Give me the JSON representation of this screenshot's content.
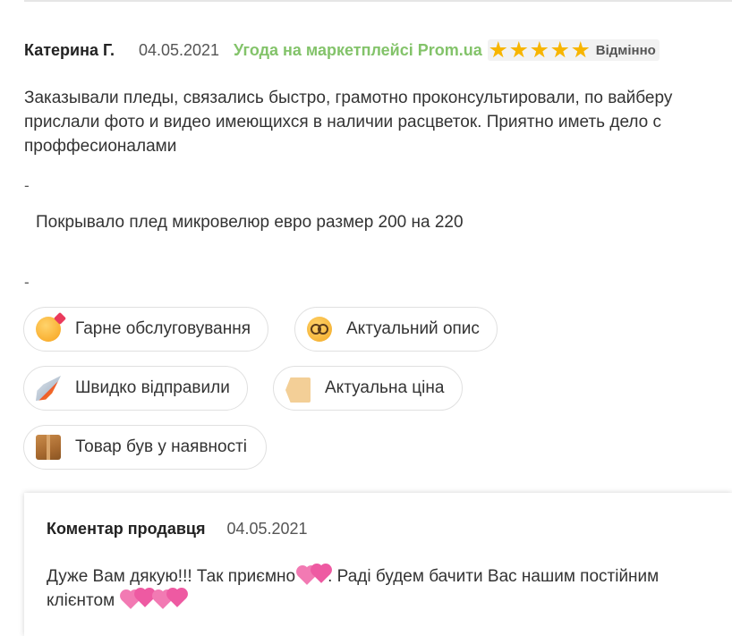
{
  "review": {
    "author": "Катерина Г.",
    "date": "04.05.2021",
    "deal_label": "Угода на маркетплейсі Prom.ua",
    "rating": 5,
    "rating_max": 5,
    "rating_word": "Відмінно",
    "text": "Заказывали пледы, связались быстро, грамотно проконсультировали, по вайберу прислали фото и видео имеющихся в наличии расцветок. Приятно иметь дело с проффесионалами",
    "separator_top": "-",
    "product": "Покрывало плед микровелюр евро размер 200 на 220",
    "separator_bottom": "-",
    "tags": [
      {
        "label": "Гарне обслуговування",
        "icon": "smiling-face-with-hearts-icon"
      },
      {
        "label": "Актуальний опис",
        "icon": "nerd-face-icon"
      },
      {
        "label": "Швидко відправили",
        "icon": "rocket-icon"
      },
      {
        "label": "Актуальна ціна",
        "icon": "price-tag-icon"
      },
      {
        "label": "Товар був у наявності",
        "icon": "package-icon"
      }
    ]
  },
  "seller_comment": {
    "title": "Коментар продавця",
    "date": "04.05.2021",
    "text_part1": "Дуже Вам дякую!!! Так приємно",
    "text_part2": ". Раді будем бачити Вас нашим постійним клієнтом ",
    "icon": "two-hearts-icon"
  },
  "colors": {
    "deal_green": "#83c36a",
    "star": "#f7b500",
    "heart_pink": "#f27ab3"
  }
}
